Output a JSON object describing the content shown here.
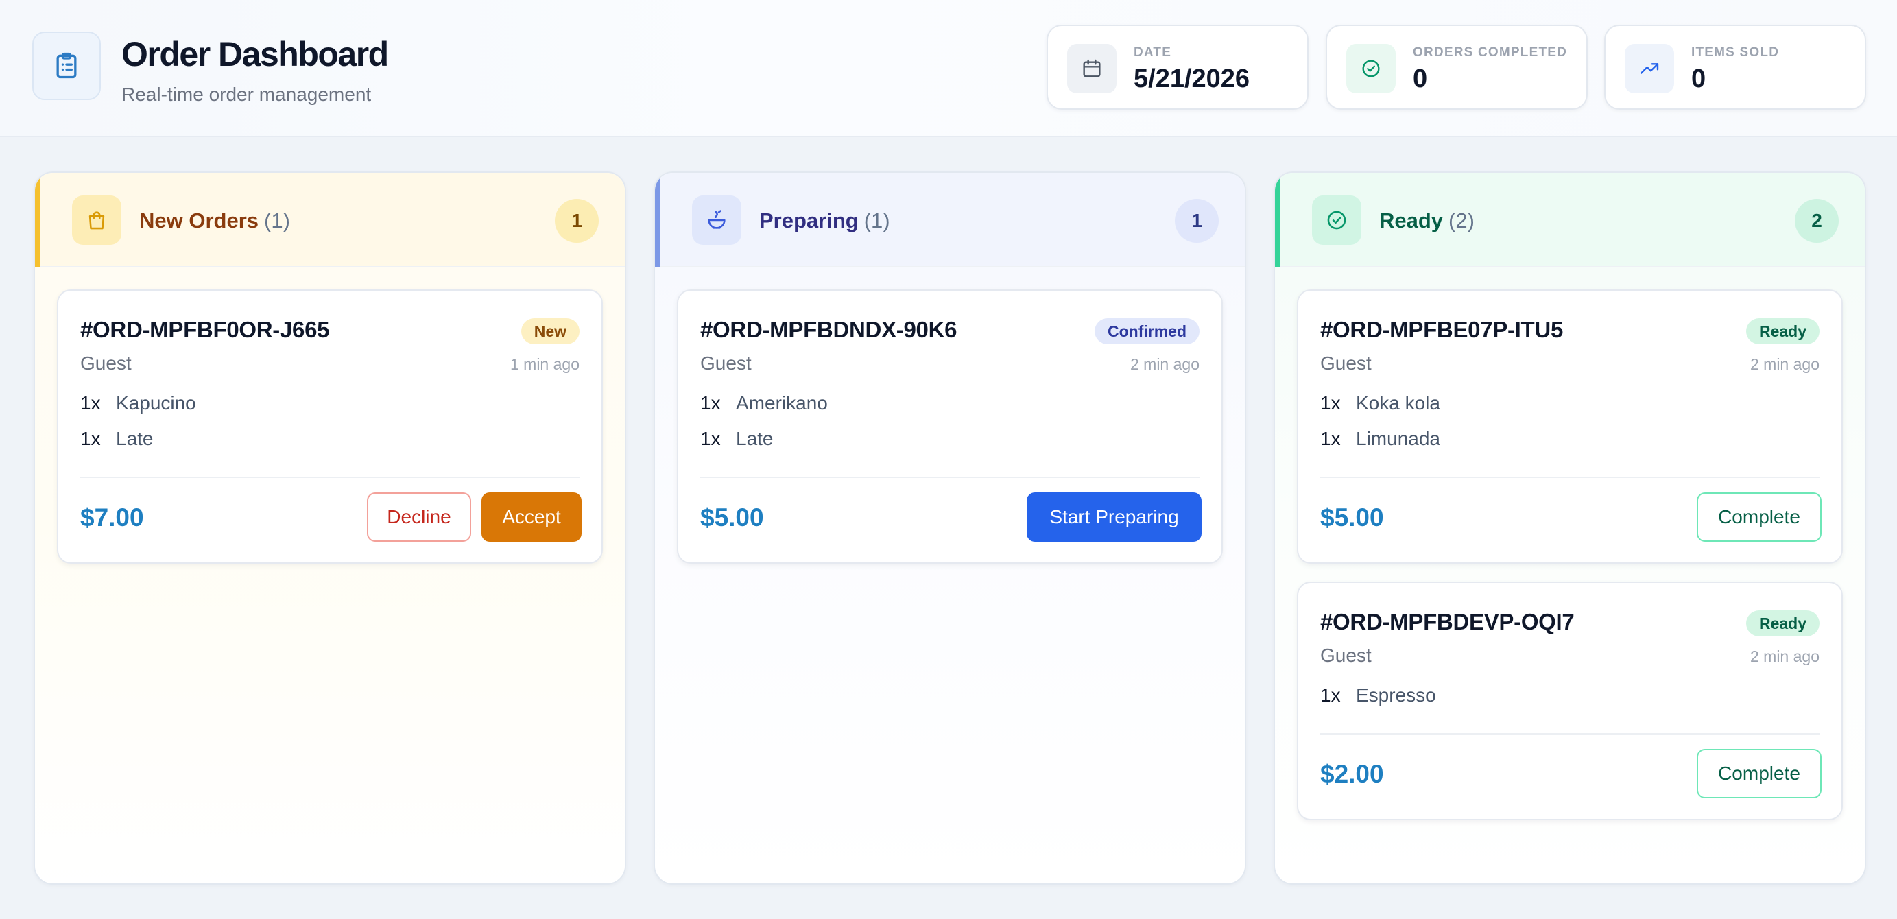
{
  "header": {
    "title": "Order Dashboard",
    "subtitle": "Real-time order management",
    "stats": [
      {
        "label": "Date",
        "value": "5/21/2026",
        "icon": "calendar-icon"
      },
      {
        "label": "Orders Completed",
        "value": "0",
        "icon": "check-circle-icon"
      },
      {
        "label": "Items Sold",
        "value": "0",
        "icon": "trending-up-icon"
      }
    ]
  },
  "colors": {
    "new_accent": "#f5c02e",
    "preparing_accent": "#7c98e6",
    "ready_accent": "#34d399",
    "price": "#1e7fc1",
    "accept": "#d97706",
    "decline": "#dc2626",
    "start_preparing": "#2563eb",
    "complete": "#059669"
  },
  "columns": [
    {
      "title": "New Orders",
      "count_text": "(1)",
      "badge": "1",
      "icon": "shopping-bag-icon",
      "orders": [
        {
          "id": "#ORD-MPFBF0OR-J665",
          "status": "New",
          "customer": "Guest",
          "time": "1 min ago",
          "items": [
            {
              "qty": "1x",
              "name": "Kapucino"
            },
            {
              "qty": "1x",
              "name": "Late"
            }
          ],
          "total": "$7.00",
          "actions": [
            "Decline",
            "Accept"
          ]
        }
      ]
    },
    {
      "title": "Preparing",
      "count_text": "(1)",
      "badge": "1",
      "icon": "soup-bowl-icon",
      "orders": [
        {
          "id": "#ORD-MPFBDNDX-90K6",
          "status": "Confirmed",
          "customer": "Guest",
          "time": "2 min ago",
          "items": [
            {
              "qty": "1x",
              "name": "Amerikano"
            },
            {
              "qty": "1x",
              "name": "Late"
            }
          ],
          "total": "$5.00",
          "actions": [
            "Start Preparing"
          ]
        }
      ]
    },
    {
      "title": "Ready",
      "count_text": "(2)",
      "badge": "2",
      "icon": "check-circle-icon",
      "orders": [
        {
          "id": "#ORD-MPFBE07P-ITU5",
          "status": "Ready",
          "customer": "Guest",
          "time": "2 min ago",
          "items": [
            {
              "qty": "1x",
              "name": "Koka kola"
            },
            {
              "qty": "1x",
              "name": "Limunada"
            }
          ],
          "total": "$5.00",
          "actions": [
            "Complete"
          ]
        },
        {
          "id": "#ORD-MPFBDEVP-OQI7",
          "status": "Ready",
          "customer": "Guest",
          "time": "2 min ago",
          "items": [
            {
              "qty": "1x",
              "name": "Espresso"
            }
          ],
          "total": "$2.00",
          "actions": [
            "Complete"
          ]
        }
      ]
    }
  ]
}
